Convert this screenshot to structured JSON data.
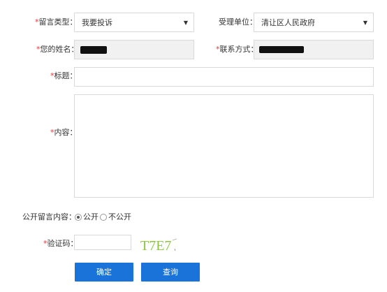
{
  "form": {
    "required_mark": "*",
    "type": {
      "label": "留言类型：",
      "value": "我要投诉"
    },
    "unit": {
      "label": "受理单位：",
      "value": "清让区人民政府"
    },
    "name": {
      "label": "您的姓名："
    },
    "contact": {
      "label": "联系方式："
    },
    "title": {
      "label": "标题：",
      "value": ""
    },
    "content": {
      "label": "内容：",
      "value": ""
    },
    "public": {
      "label": "公开留言内容：",
      "options": [
        "公开",
        "不公开"
      ],
      "selected": "公开"
    },
    "captcha": {
      "label": "验证码：",
      "value": "",
      "code": "T7E7"
    }
  },
  "buttons": {
    "submit": "确定",
    "query": "查询"
  },
  "colors": {
    "required": "#e4393c",
    "button": "#1a73d9",
    "readonly_bg": "#f1f1f1",
    "captcha_green": "#8cc63f"
  },
  "icons": {
    "dropdown": "triangle-down",
    "radio": "circle"
  }
}
